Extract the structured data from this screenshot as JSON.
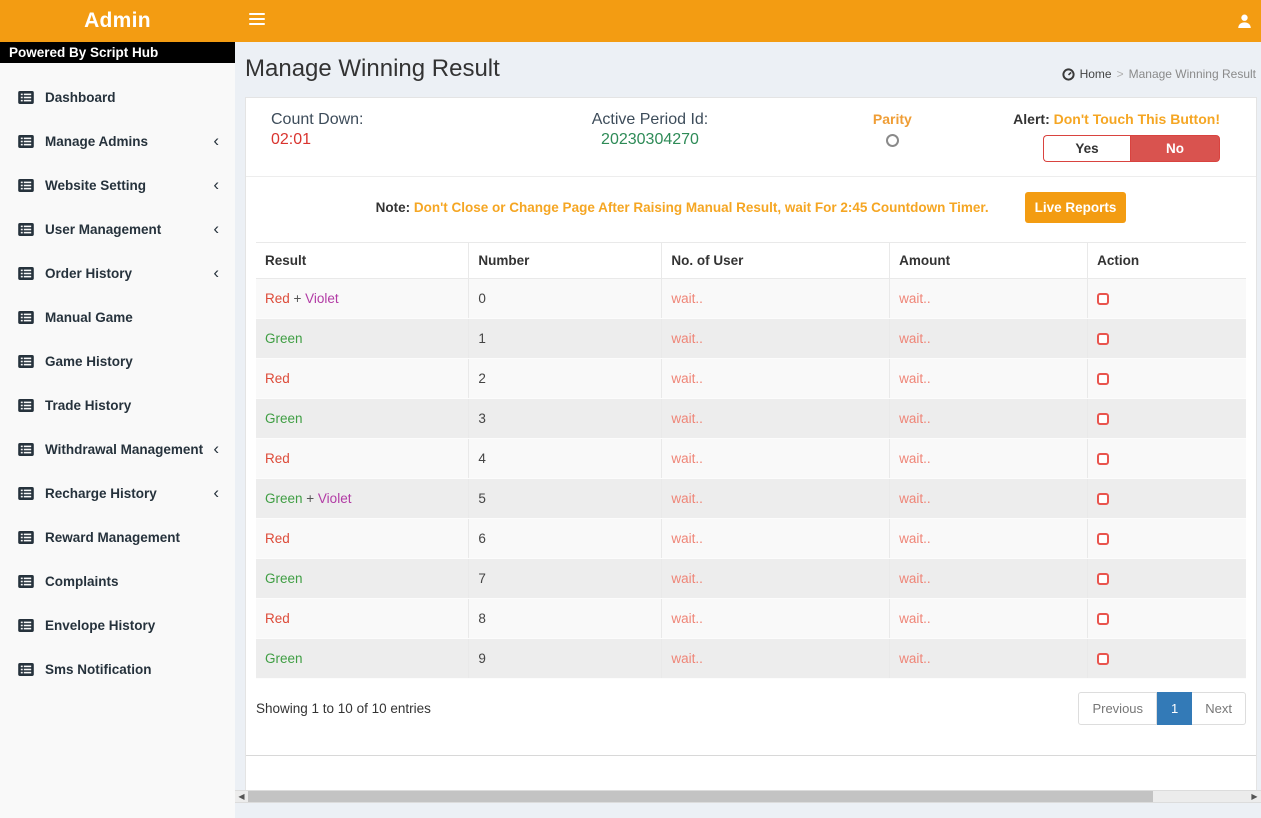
{
  "theme": {
    "navbar_orange": "#f39c12",
    "danger_red": "#d9534f",
    "pagination_blue": "#337ab7",
    "content_bg": "#ecf0f5",
    "wait_color": "#ef8577"
  },
  "colors": {
    "red": "#dd4b39",
    "green": "#3f9e43",
    "violet": "#b23ba5",
    "plus": "#555555"
  },
  "header": {
    "brand": "Admin"
  },
  "sidebar": {
    "powered_by": "Powered By Script Hub",
    "items": [
      {
        "label": "Dashboard",
        "has_submenu": false
      },
      {
        "label": "Manage Admins",
        "has_submenu": true
      },
      {
        "label": "Website Setting",
        "has_submenu": true
      },
      {
        "label": "User Management",
        "has_submenu": true
      },
      {
        "label": "Order History",
        "has_submenu": true
      },
      {
        "label": "Manual Game",
        "has_submenu": false
      },
      {
        "label": "Game History",
        "has_submenu": false
      },
      {
        "label": "Trade History",
        "has_submenu": false
      },
      {
        "label": "Withdrawal Management",
        "has_submenu": true
      },
      {
        "label": "Recharge History",
        "has_submenu": true
      },
      {
        "label": "Reward Management",
        "has_submenu": false
      },
      {
        "label": "Complaints",
        "has_submenu": false
      },
      {
        "label": "Envelope History",
        "has_submenu": false
      },
      {
        "label": "Sms Notification",
        "has_submenu": false
      }
    ]
  },
  "page": {
    "title": "Manage Winning Result",
    "breadcrumb": {
      "home": "Home",
      "separator": ">",
      "current": "Manage Winning Result"
    }
  },
  "panel": {
    "countdown_label": "Count Down:",
    "countdown_value": "02:01",
    "period_label": "Active Period Id:",
    "period_value": "20230304270",
    "parity_label": "Parity",
    "alert_label": "Alert:",
    "alert_text": "Don't Touch This Button!",
    "yes_label": "Yes",
    "no_label": "No",
    "note_label": "Note:",
    "note_text": "Don't Close or Change Page After Raising Manual Result, wait For 2:45 Countdown Timer.",
    "live_reports_label": "Live Reports"
  },
  "table": {
    "columns": [
      "Result",
      "Number",
      "No. of User",
      "Amount",
      "Action"
    ],
    "rows": [
      {
        "result": [
          {
            "text": "Red",
            "color": "red"
          },
          {
            "text": "Violet",
            "color": "violet"
          }
        ],
        "number": "0",
        "users": "wait..",
        "amount": "wait.."
      },
      {
        "result": [
          {
            "text": "Green",
            "color": "green"
          }
        ],
        "number": "1",
        "users": "wait..",
        "amount": "wait.."
      },
      {
        "result": [
          {
            "text": "Red",
            "color": "red"
          }
        ],
        "number": "2",
        "users": "wait..",
        "amount": "wait.."
      },
      {
        "result": [
          {
            "text": "Green",
            "color": "green"
          }
        ],
        "number": "3",
        "users": "wait..",
        "amount": "wait.."
      },
      {
        "result": [
          {
            "text": "Red",
            "color": "red"
          }
        ],
        "number": "4",
        "users": "wait..",
        "amount": "wait.."
      },
      {
        "result": [
          {
            "text": "Green",
            "color": "green"
          },
          {
            "text": "Violet",
            "color": "violet"
          }
        ],
        "number": "5",
        "users": "wait..",
        "amount": "wait.."
      },
      {
        "result": [
          {
            "text": "Red",
            "color": "red"
          }
        ],
        "number": "6",
        "users": "wait..",
        "amount": "wait.."
      },
      {
        "result": [
          {
            "text": "Green",
            "color": "green"
          }
        ],
        "number": "7",
        "users": "wait..",
        "amount": "wait.."
      },
      {
        "result": [
          {
            "text": "Red",
            "color": "red"
          }
        ],
        "number": "8",
        "users": "wait..",
        "amount": "wait.."
      },
      {
        "result": [
          {
            "text": "Green",
            "color": "green"
          }
        ],
        "number": "9",
        "users": "wait..",
        "amount": "wait.."
      }
    ],
    "summary": "Showing 1 to 10 of 10 entries"
  },
  "pagination": {
    "previous": "Previous",
    "page": "1",
    "next": "Next"
  }
}
